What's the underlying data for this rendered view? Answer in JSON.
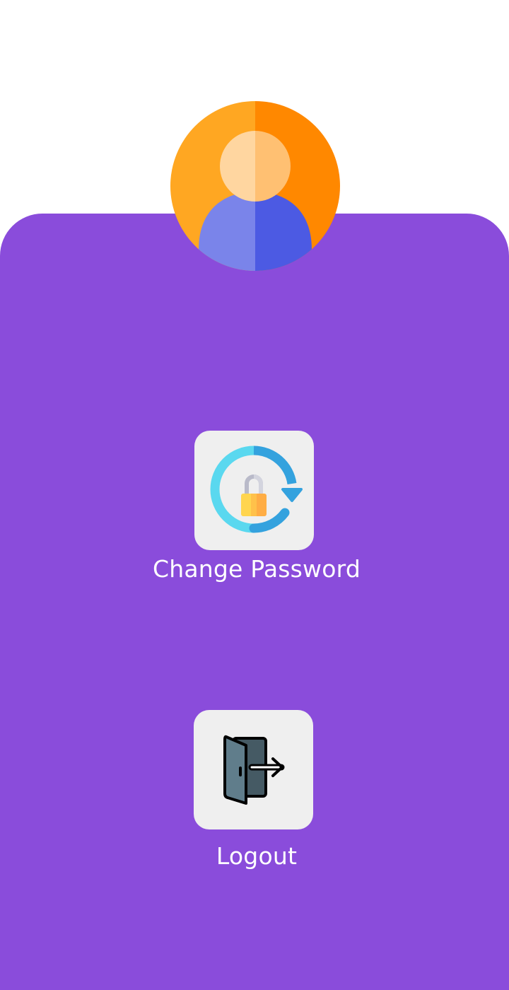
{
  "profile": {
    "avatar_icon": "user-avatar-icon"
  },
  "actions": {
    "change_password": {
      "label": "Change Password",
      "icon": "lock-refresh-icon"
    },
    "logout": {
      "label": "Logout",
      "icon": "door-exit-icon"
    }
  },
  "colors": {
    "background": "#ffffff",
    "panel": "#8a4cdb",
    "tile": "#efefef",
    "label_text": "#ffffff"
  }
}
